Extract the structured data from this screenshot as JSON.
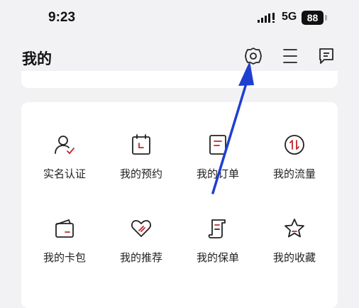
{
  "status_bar": {
    "time": "9:23",
    "network": "5G",
    "battery": "88"
  },
  "header": {
    "title": "我的",
    "icons": [
      "settings-icon",
      "menu-icon",
      "message-icon"
    ]
  },
  "grid": {
    "items": [
      {
        "label": "实名认证",
        "icon": "user-verify-icon"
      },
      {
        "label": "我的预约",
        "icon": "calendar-icon"
      },
      {
        "label": "我的订单",
        "icon": "order-icon"
      },
      {
        "label": "我的流量",
        "icon": "data-flow-icon"
      },
      {
        "label": "我的卡包",
        "icon": "wallet-icon"
      },
      {
        "label": "我的推荐",
        "icon": "recommend-icon"
      },
      {
        "label": "我的保单",
        "icon": "policy-icon"
      },
      {
        "label": "我的收藏",
        "icon": "star-icon"
      }
    ]
  },
  "colors": {
    "accent": "#c0272d",
    "annotation_arrow": "#1f3fd1",
    "background": "#f2f2f4"
  }
}
